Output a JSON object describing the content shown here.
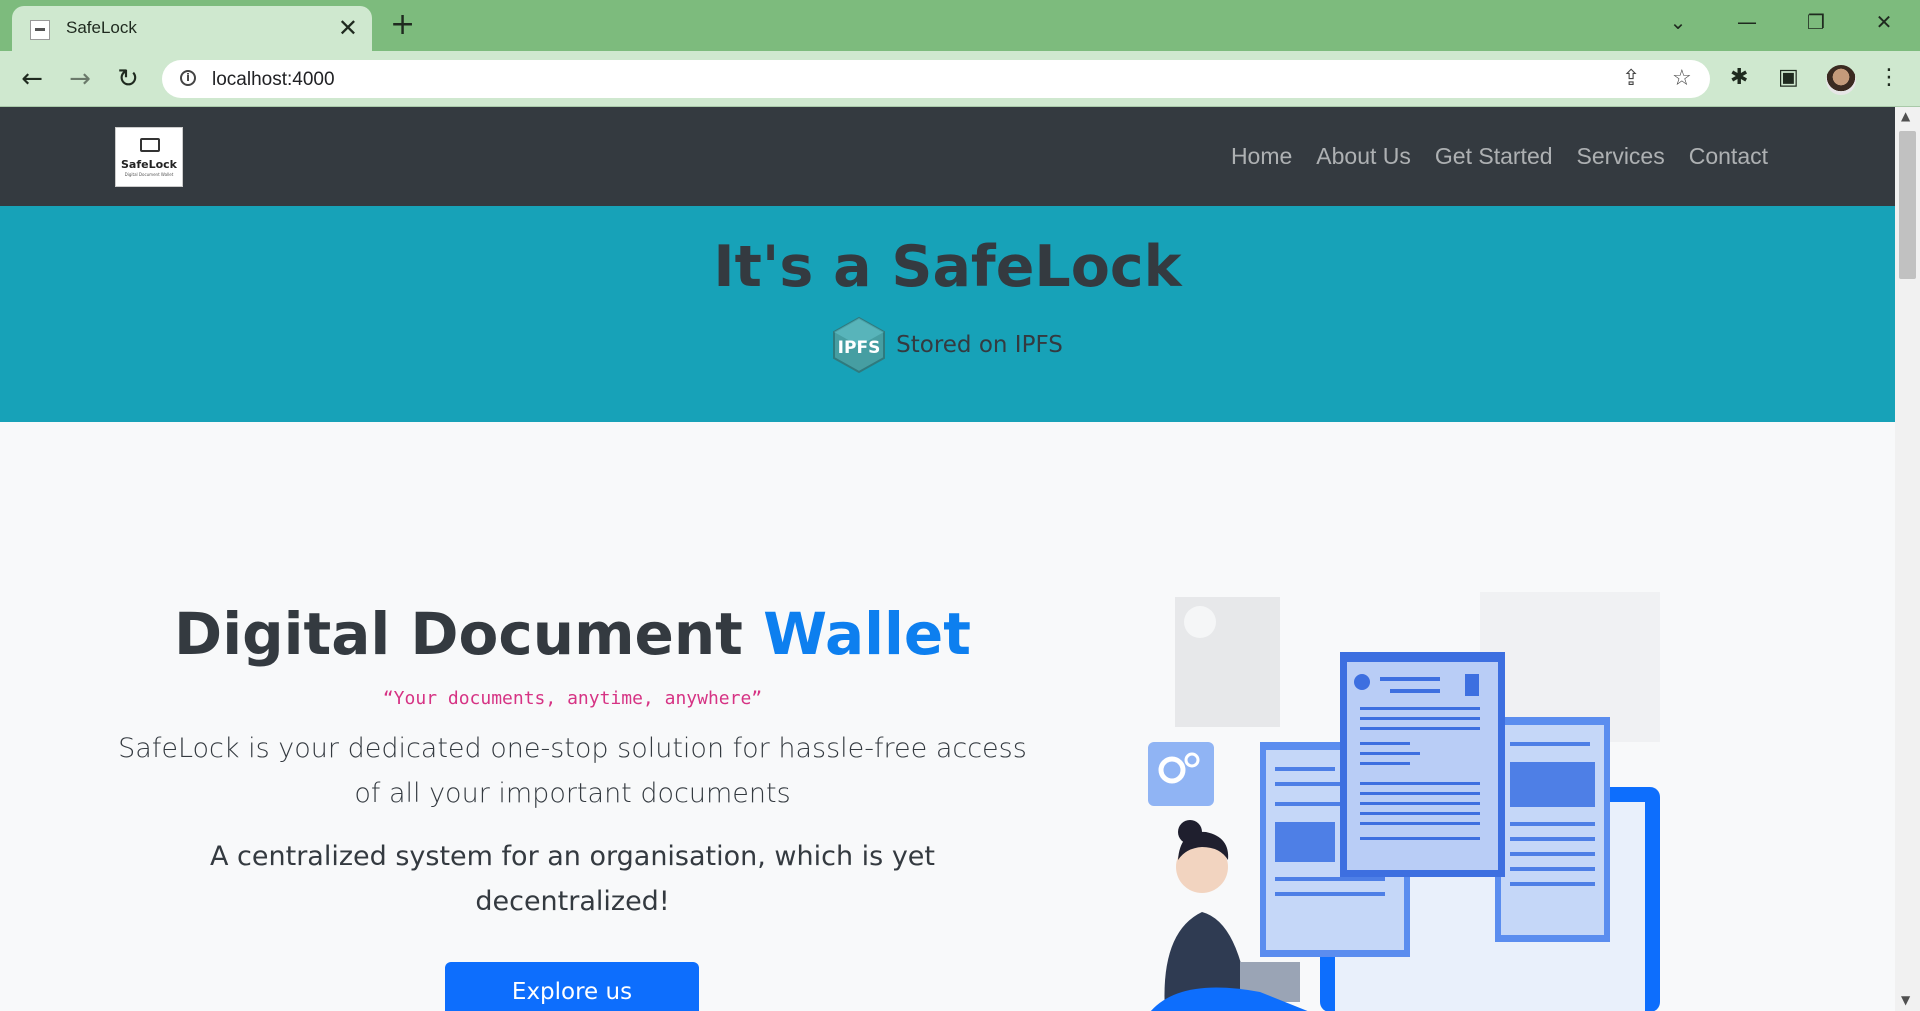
{
  "browser": {
    "tab_title": "SafeLock",
    "tab_close": "✕",
    "new_tab": "+",
    "url": "localhost:4000",
    "window_controls": {
      "dropdown": "⌄",
      "minimize": "—",
      "restore": "❐",
      "close": "✕"
    }
  },
  "navbar": {
    "brand_text": "SafeLock",
    "brand_sub": "Digital Document Wallet",
    "links": [
      "Home",
      "About Us",
      "Get Started",
      "Services",
      "Contact"
    ]
  },
  "hero": {
    "title": "It's a SafeLock",
    "ipfs_logo_text": "IPFS",
    "ipfs_caption": "Stored on IPFS"
  },
  "main": {
    "heading_prefix": "Digital Document ",
    "heading_accent": "Wallet",
    "tagline": "“Your documents, anytime, anywhere”",
    "paragraph1": "SafeLock is your dedicated one-stop solution for hassle-free access of all your important documents",
    "paragraph2": "A centralized system for an organisation, which is yet decentralized!",
    "cta_label": "Explore us"
  },
  "colors": {
    "navbar_bg": "#343a40",
    "hero_bg": "#17a2b8",
    "accent": "#0d7fef",
    "button": "#0d6efd",
    "tagline": "#d63384",
    "browser_frame": "#7dbb7d"
  },
  "icons": [
    "back-icon",
    "forward-icon",
    "reload-icon",
    "info-icon",
    "share-icon",
    "star-icon",
    "extensions-icon",
    "side-panel-icon",
    "menu-icon",
    "ipfs-logo"
  ]
}
